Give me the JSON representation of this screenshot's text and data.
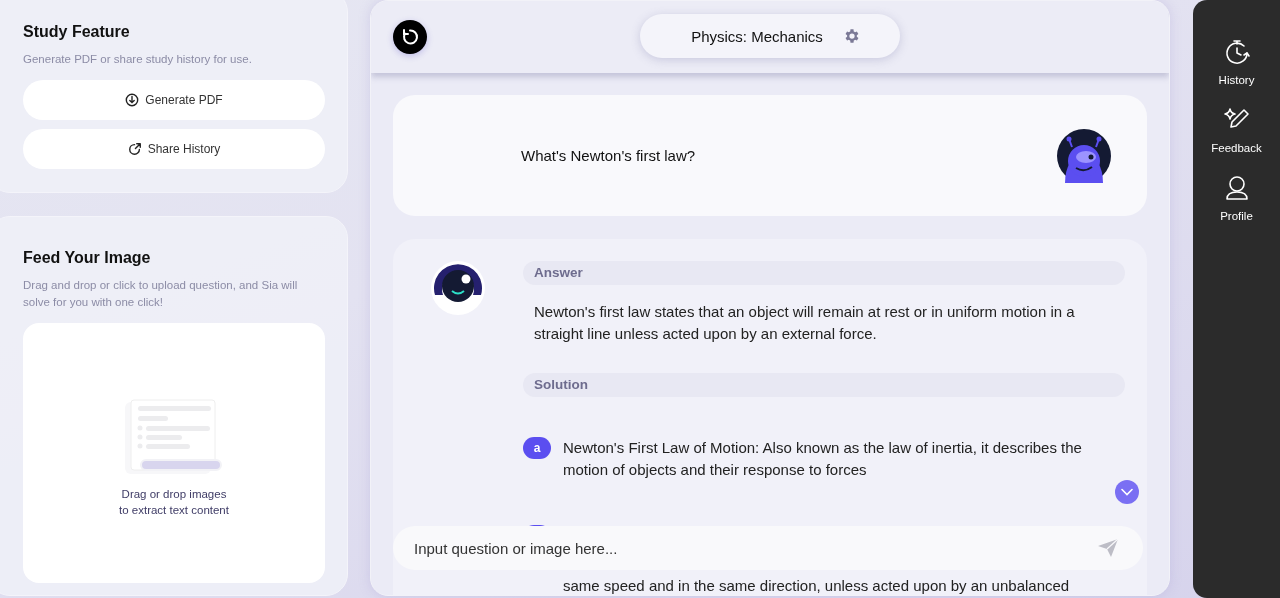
{
  "study_feature": {
    "title": "Study Feature",
    "description": "Generate PDF or share study history for use.",
    "buttons": [
      {
        "kind": "download",
        "label": "Generate PDF"
      },
      {
        "kind": "share",
        "label": "Share History"
      }
    ]
  },
  "feed_image": {
    "title": "Feed Your Image",
    "description": "Drag and drop or click to upload question, and Sia will solve for you with one click!",
    "drop_hint": [
      "Drag or drop images",
      "to extract text content"
    ]
  },
  "chat_header": {
    "subject": "Physics: Mechanics"
  },
  "question": {
    "text": "What's Newton's first law?"
  },
  "answer": {
    "answer_heading": "Answer",
    "answer_text": "Newton's first law states that an object will remain at rest or in uniform motion in a straight line unless acted upon by an external force.",
    "solution_heading": "Solution",
    "steps": [
      {
        "marker": "a",
        "text": "Newton's First Law of Motion: Also known as the law of inertia, it describes the motion of objects and their response to forces"
      },
      {
        "text": "same speed and in the same direction, unless acted upon by an unbalanced"
      }
    ]
  },
  "input": {
    "placeholder": "Input question or image here..."
  },
  "sidebar": {
    "items": [
      {
        "kind": "history",
        "label": "History"
      },
      {
        "kind": "feedback",
        "label": "Feedback"
      },
      {
        "kind": "profile",
        "label": "Profile"
      }
    ]
  }
}
